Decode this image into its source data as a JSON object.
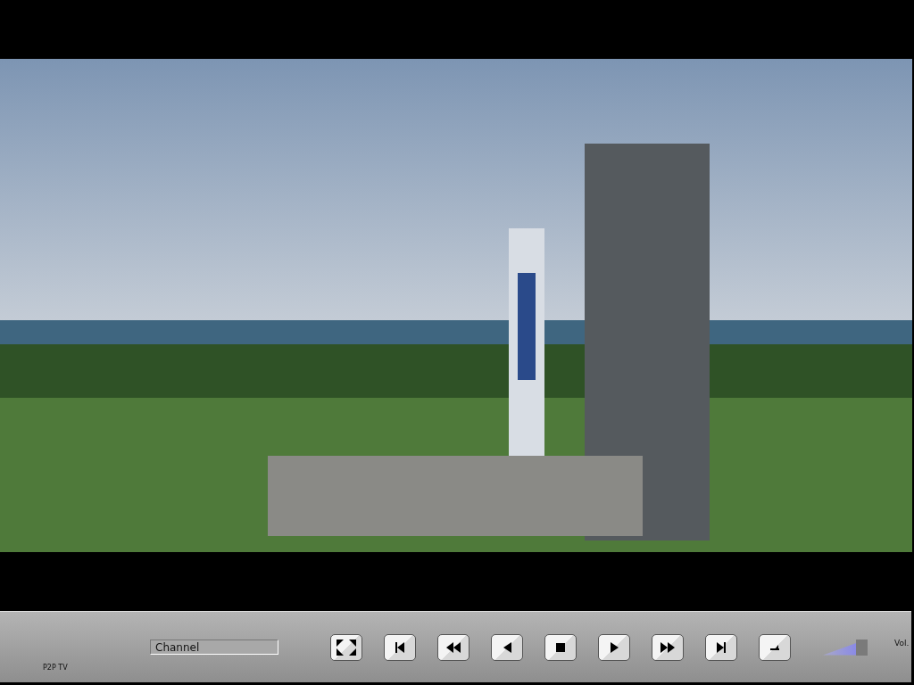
{
  "video": {
    "kind": "launch-pad"
  },
  "controls": {
    "brand": "P2P TV",
    "channel_field": {
      "value": "Channel"
    },
    "buttons": [
      {
        "kind": "fullscreen"
      },
      {
        "kind": "skip-back"
      },
      {
        "kind": "rewind"
      },
      {
        "kind": "step-back"
      },
      {
        "kind": "stop"
      },
      {
        "kind": "play"
      },
      {
        "kind": "fast-forward"
      },
      {
        "kind": "skip-forward"
      },
      {
        "kind": "eject"
      }
    ],
    "volume": {
      "level": 0.8
    },
    "volume_label": "Vol."
  }
}
